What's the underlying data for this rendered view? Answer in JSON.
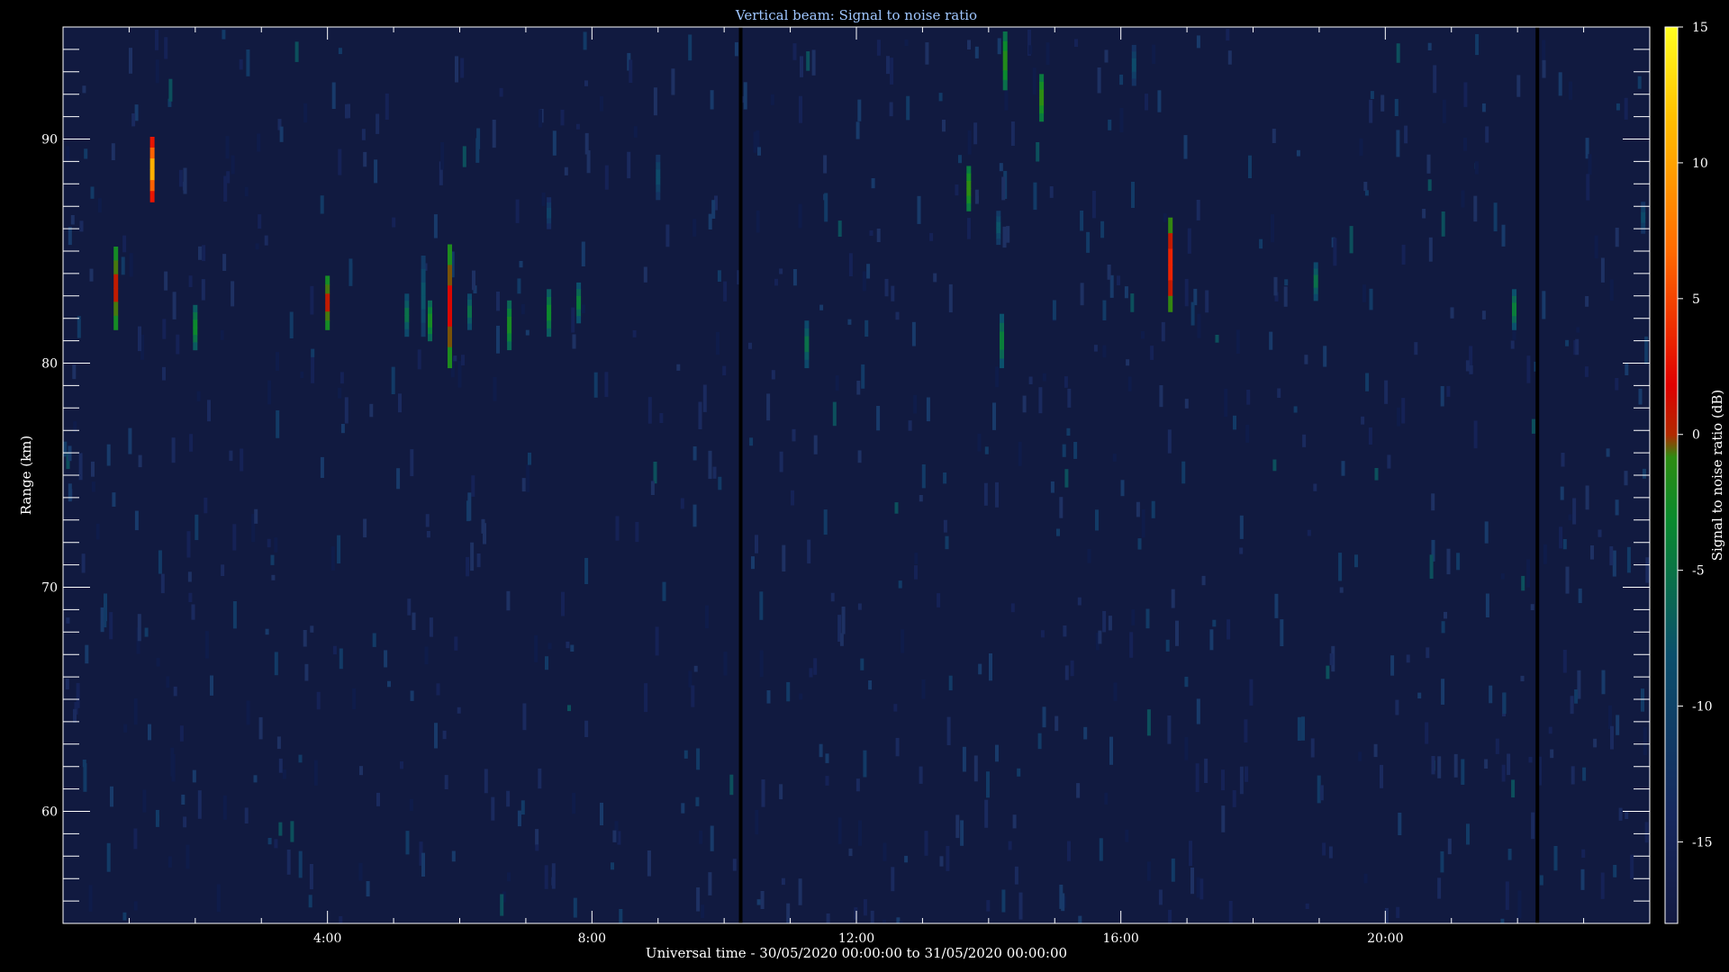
{
  "chart_data": {
    "type": "heatmap",
    "title": "Vertical beam: Signal to noise ratio",
    "xlabel": "Universal time - 30/05/2020 00:00:00 to 31/05/2020 00:00:00",
    "ylabel": "Range (km)",
    "xlim_hours": [
      0,
      24
    ],
    "ylim": [
      55,
      95
    ],
    "x_tick_labels": [
      "4:00",
      "8:00",
      "12:00",
      "16:00",
      "20:00"
    ],
    "x_tick_hours": [
      4,
      8,
      12,
      16,
      20
    ],
    "y_ticks": [
      60,
      70,
      80,
      90
    ],
    "colorbar": {
      "label": "Signal to noise ratio (dB)",
      "range": [
        -18,
        15
      ],
      "ticks": [
        15,
        10,
        5,
        0,
        -5,
        -10,
        -15
      ]
    },
    "background_snr_db": -17,
    "data_gaps_hours": [
      10.25,
      22.3
    ],
    "echoes": [
      {
        "t": 0.8,
        "r0": 81.5,
        "r1": 85.2,
        "peak_db": 2
      },
      {
        "t": 1.35,
        "r0": 87.2,
        "r1": 90.1,
        "peak_db": 12
      },
      {
        "t": 2.0,
        "r0": 80.6,
        "r1": 82.6,
        "peak_db": -4
      },
      {
        "t": 4.0,
        "r0": 81.5,
        "r1": 83.9,
        "peak_db": 2
      },
      {
        "t": 5.2,
        "r0": 81.2,
        "r1": 83.1,
        "peak_db": -6
      },
      {
        "t": 5.45,
        "r0": 81.2,
        "r1": 84.8,
        "peak_db": -8
      },
      {
        "t": 5.55,
        "r0": 81.0,
        "r1": 82.8,
        "peak_db": -3
      },
      {
        "t": 5.85,
        "r0": 79.8,
        "r1": 85.3,
        "peak_db": 3
      },
      {
        "t": 6.15,
        "r0": 81.5,
        "r1": 83.1,
        "peak_db": -6
      },
      {
        "t": 6.75,
        "r0": 80.6,
        "r1": 82.8,
        "peak_db": -3
      },
      {
        "t": 7.35,
        "r0": 81.2,
        "r1": 83.3,
        "peak_db": -4
      },
      {
        "t": 7.35,
        "r0": 86.0,
        "r1": 87.4,
        "peak_db": -10
      },
      {
        "t": 7.8,
        "r0": 81.8,
        "r1": 83.6,
        "peak_db": -5
      },
      {
        "t": 9.0,
        "r0": 87.3,
        "r1": 89.3,
        "peak_db": -9
      },
      {
        "t": 11.25,
        "r0": 79.8,
        "r1": 81.9,
        "peak_db": -6
      },
      {
        "t": 13.7,
        "r0": 86.8,
        "r1": 88.8,
        "peak_db": -1
      },
      {
        "t": 14.15,
        "r0": 85.3,
        "r1": 86.8,
        "peak_db": -8
      },
      {
        "t": 14.2,
        "r0": 79.8,
        "r1": 82.2,
        "peak_db": -5
      },
      {
        "t": 14.25,
        "r0": 92.2,
        "r1": 94.8,
        "peak_db": -2
      },
      {
        "t": 14.8,
        "r0": 90.8,
        "r1": 92.9,
        "peak_db": -1
      },
      {
        "t": 16.2,
        "r0": 92.4,
        "r1": 94.2,
        "peak_db": -9
      },
      {
        "t": 16.75,
        "r0": 82.3,
        "r1": 86.5,
        "peak_db": 5
      },
      {
        "t": 18.95,
        "r0": 82.8,
        "r1": 84.5,
        "peak_db": -6
      },
      {
        "t": 21.95,
        "r0": 81.5,
        "r1": 83.3,
        "peak_db": -5
      },
      {
        "t": 23.9,
        "r0": 85.8,
        "r1": 87.2,
        "peak_db": -9
      }
    ]
  }
}
